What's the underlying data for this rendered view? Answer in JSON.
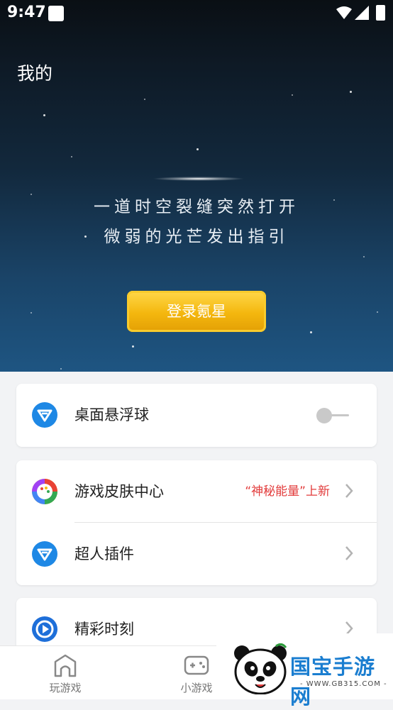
{
  "status_bar": {
    "time": "9:47"
  },
  "header": {
    "title": "我的"
  },
  "hero": {
    "line1": "一道时空裂缝突然打开",
    "line2": "微弱的光芒发出指引",
    "login_label": "登录氪星"
  },
  "settings": {
    "float_ball": {
      "label": "桌面悬浮球",
      "enabled": false,
      "icon": "brand-v-icon"
    },
    "skin_center": {
      "label": "游戏皮肤中心",
      "promo": "“神秘能量”上新",
      "icon": "palette-icon"
    },
    "plugin": {
      "label": "超人插件",
      "icon": "brand-v-icon"
    },
    "highlights": {
      "label": "精彩时刻",
      "icon": "play-circle-icon"
    }
  },
  "tabbar": {
    "tabs": [
      {
        "label": "玩游戏",
        "icon": "home-icon"
      },
      {
        "label": "小游戏",
        "icon": "gamepad-icon"
      }
    ]
  },
  "watermark": {
    "brand": "国宝手游网",
    "url": "- WWW.GB315.COM -"
  },
  "colors": {
    "accent": "#1b7ed0",
    "promo": "#e23b3b",
    "login": "#f4b70e"
  }
}
